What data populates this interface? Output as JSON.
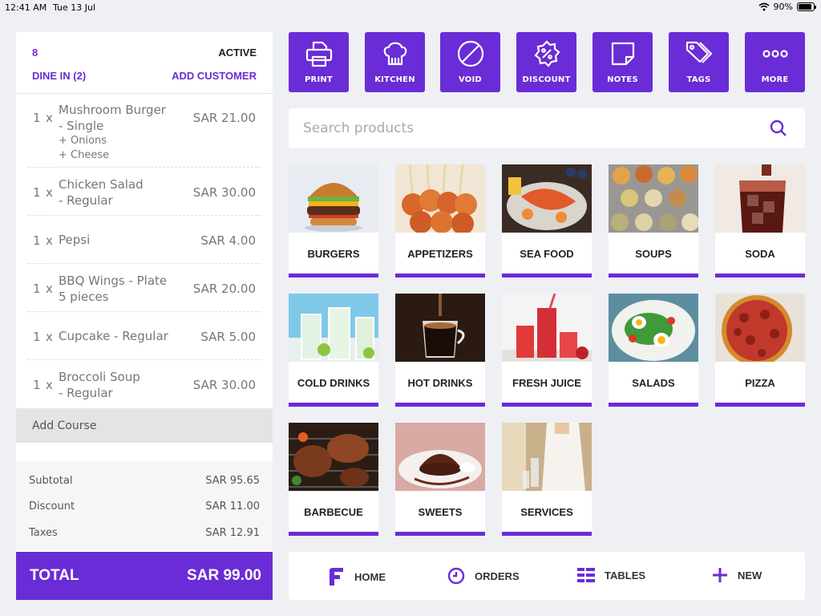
{
  "status_bar": {
    "time": "12:41 AM",
    "date": "Tue 13 Jul",
    "battery_percent": 90,
    "battery_label": "90%"
  },
  "order": {
    "number": "8",
    "status": "ACTIVE",
    "type": "DINE IN (2)",
    "add_customer": "ADD CUSTOMER",
    "items": [
      {
        "qty": "1",
        "x": "x",
        "name_line1": "Mushroom Burger",
        "name_line2": "- Single",
        "modifiers": [
          "+ Onions",
          "+ Cheese"
        ],
        "price": "SAR 21.00"
      },
      {
        "qty": "1",
        "x": "x",
        "name_line1": "Chicken Salad",
        "name_line2": "- Regular",
        "modifiers": [],
        "price": "SAR 30.00"
      },
      {
        "qty": "1",
        "x": "x",
        "name_line1": "Pepsi",
        "name_line2": "",
        "modifiers": [],
        "price": "SAR 4.00"
      },
      {
        "qty": "1",
        "x": "x",
        "name_line1": "BBQ Wings - Plate",
        "name_line2": "5 pieces",
        "modifiers": [],
        "price": "SAR 20.00"
      },
      {
        "qty": "1",
        "x": "x",
        "name_line1": "Cupcake - Regular",
        "name_line2": "",
        "modifiers": [],
        "price": "SAR 5.00"
      },
      {
        "qty": "1",
        "x": "x",
        "name_line1": "Broccoli Soup",
        "name_line2": "- Regular",
        "modifiers": [],
        "price": "SAR 30.00"
      }
    ],
    "add_course": "Add Course",
    "subtotal_label": "Subtotal",
    "subtotal": "SAR 95.65",
    "discount_label": "Discount",
    "discount": "SAR 11.00",
    "taxes_label": "Taxes",
    "taxes": "SAR 12.91",
    "total_label": "TOTAL",
    "total": "SAR 99.00"
  },
  "actions": [
    {
      "label": "PRINT",
      "icon": "printer-icon"
    },
    {
      "label": "KITCHEN",
      "icon": "chef-hat-icon"
    },
    {
      "label": "VOID",
      "icon": "void-icon"
    },
    {
      "label": "DISCOUNT",
      "icon": "discount-badge-icon"
    },
    {
      "label": "NOTES",
      "icon": "note-icon"
    },
    {
      "label": "TAGS",
      "icon": "tags-icon"
    },
    {
      "label": "MORE",
      "icon": "more-icon"
    }
  ],
  "search": {
    "placeholder": "Search products"
  },
  "categories": [
    {
      "name": "BURGERS"
    },
    {
      "name": "APPETIZERS"
    },
    {
      "name": "SEA FOOD"
    },
    {
      "name": "SOUPS"
    },
    {
      "name": "SODA"
    },
    {
      "name": "COLD DRINKS"
    },
    {
      "name": "HOT DRINKS"
    },
    {
      "name": "FRESH JUICE"
    },
    {
      "name": "SALADS"
    },
    {
      "name": "PIZZA"
    },
    {
      "name": "BARBECUE"
    },
    {
      "name": "SWEETS"
    },
    {
      "name": "SERVICES"
    }
  ],
  "nav": [
    {
      "label": "HOME",
      "icon": "home-logo-icon"
    },
    {
      "label": "ORDERS",
      "icon": "clock-icon"
    },
    {
      "label": "TABLES",
      "icon": "tables-grid-icon"
    },
    {
      "label": "NEW",
      "icon": "plus-icon"
    }
  ],
  "colors": {
    "accent": "#6a2cd6",
    "background": "#eef0f4",
    "panel": "#ffffff"
  }
}
